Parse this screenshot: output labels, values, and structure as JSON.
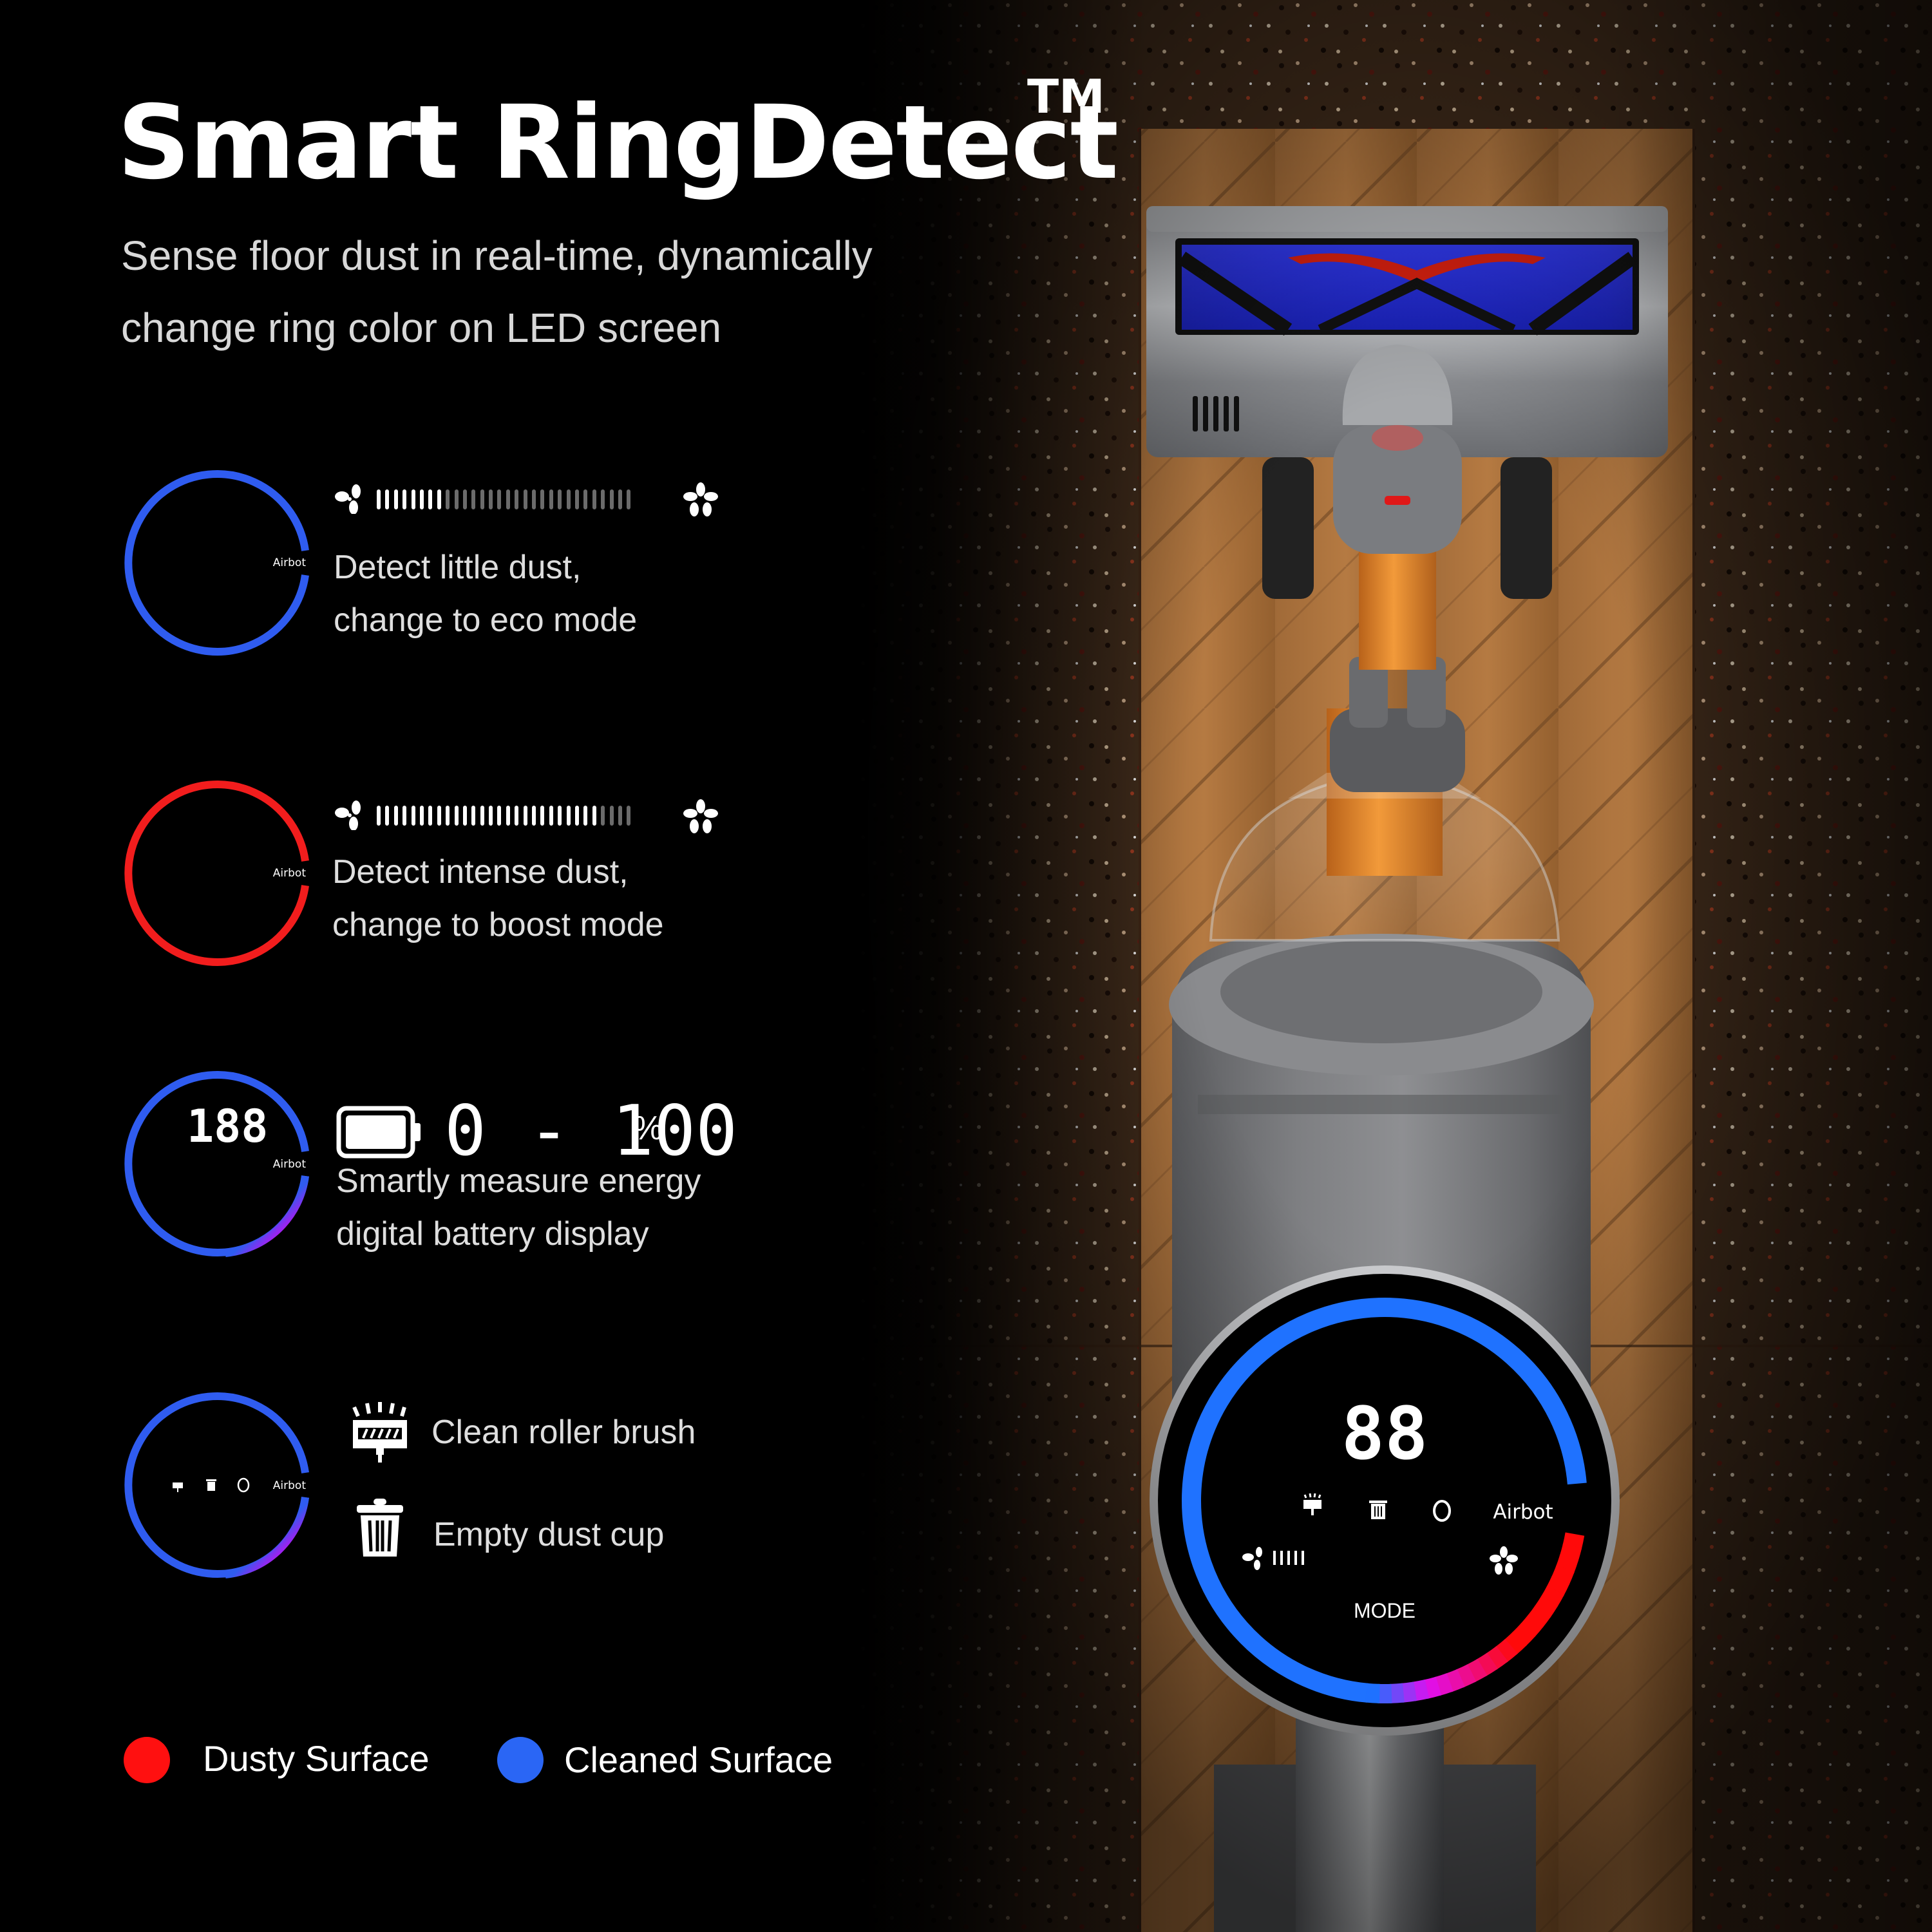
{
  "header": {
    "title": "Smart RingDetect",
    "trademark": "TM",
    "subtitle_lines": [
      "Sense floor dust in real-time, dynamically",
      "change ring color on LED screen"
    ]
  },
  "features": [
    {
      "id": "eco",
      "ring_color": "#2f5cf0",
      "ring_brand": "Airbot",
      "suction_bars": {
        "total": 30,
        "active": 8
      },
      "low_icon": "fan-low-icon",
      "high_icon": "fan-high-icon",
      "lines": [
        "Detect little dust,",
        "change to eco mode"
      ]
    },
    {
      "id": "boost",
      "ring_color": "#f21d1d",
      "ring_brand": "Airbot",
      "suction_bars": {
        "total": 30,
        "active": 26
      },
      "low_icon": "fan-low-icon",
      "high_icon": "fan-high-icon",
      "lines": [
        "Detect intense dust,",
        "change to boost mode"
      ]
    },
    {
      "id": "battery",
      "ring_brand": "Airbot",
      "ring_digits": "188",
      "battery_icon": "battery-icon",
      "range_text": "0 - 100",
      "percent_sign": "%",
      "lines": [
        "Smartly measure energy",
        "digital battery display"
      ]
    },
    {
      "id": "maintenance",
      "ring_brand": "Airbot",
      "items": [
        {
          "icon": "roller-brush-icon",
          "label": "Clean roller brush"
        },
        {
          "icon": "trash-icon",
          "label": "Empty dust cup"
        }
      ]
    }
  ],
  "legend": [
    {
      "label": "Dusty Surface",
      "color": "#ff1010"
    },
    {
      "label": "Cleaned Surface",
      "color": "#2a66f5"
    }
  ],
  "device_display": {
    "digits": "88",
    "brand": "Airbot",
    "mode_label": "MODE",
    "suction_bars_active": 5,
    "ring_colors": {
      "blue": "#1f72ff",
      "magenta": "#e010f0",
      "red": "#ff0a0a"
    }
  },
  "colors": {
    "background": "#000000",
    "text_primary": "#ffffff",
    "text_secondary": "#d8d8d8",
    "vacuum_orange": "#e88a2c",
    "vacuum_gray": "#7a7a7c",
    "brush_blue": "#2a35e6",
    "floor_wood": "#8a5a2e"
  }
}
